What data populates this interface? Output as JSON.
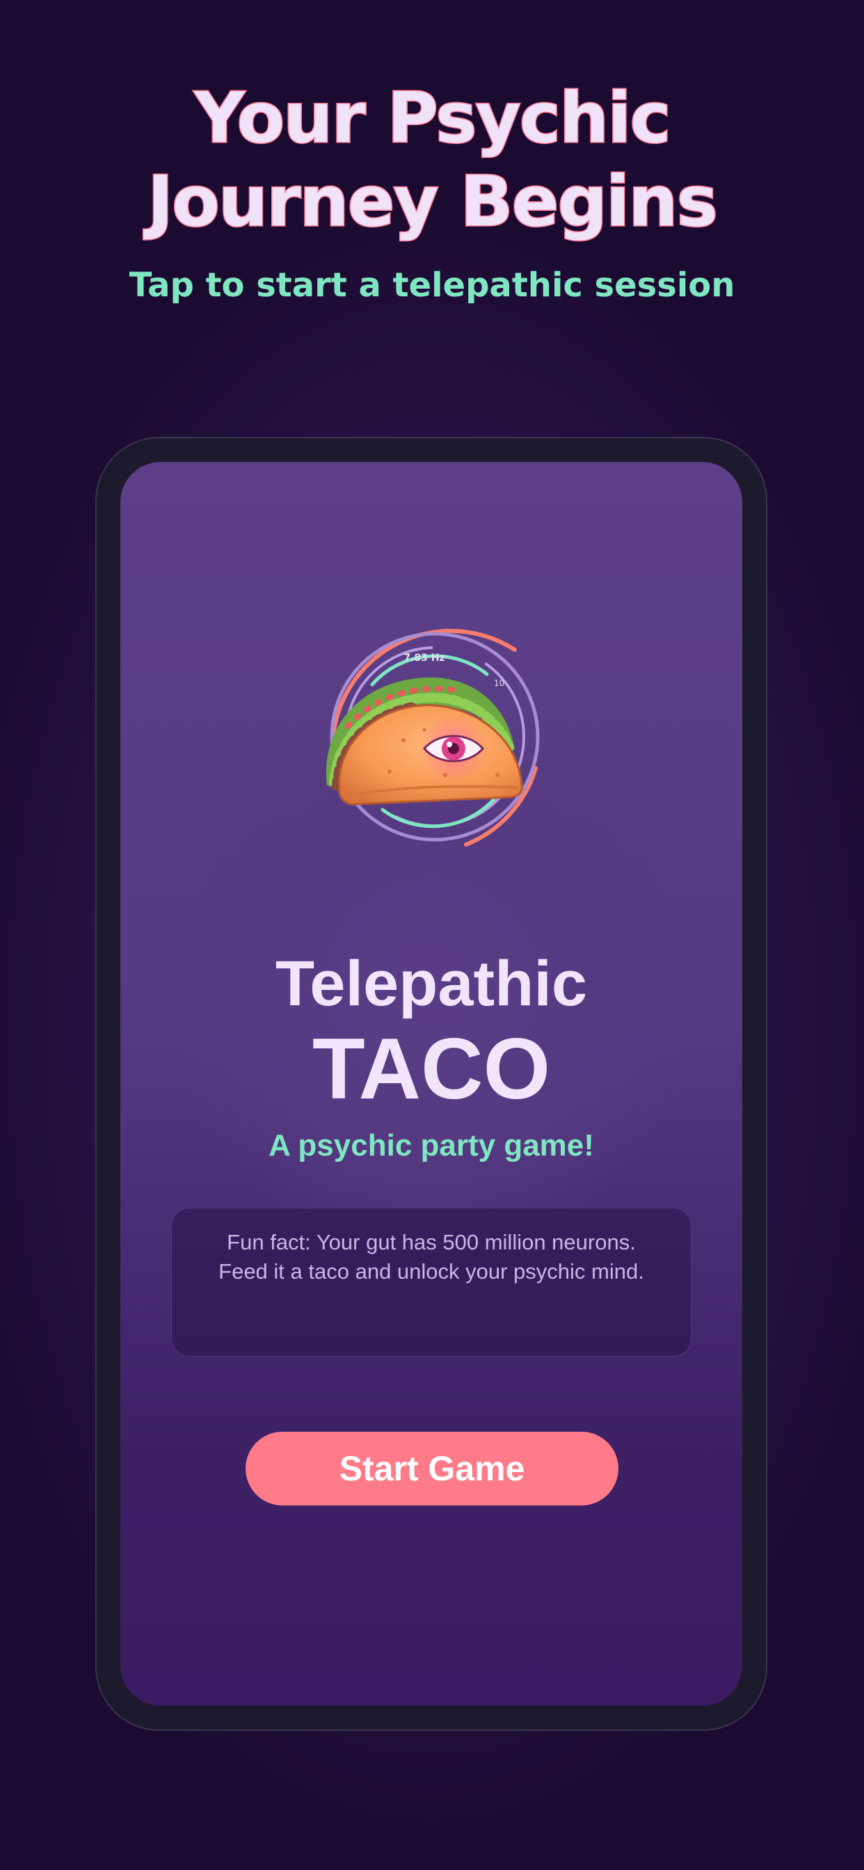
{
  "header": {
    "title_line1": "Your Psychic",
    "title_line2": "Journey Begins",
    "subtitle": "Tap to start a telepathic session"
  },
  "emblem": {
    "icon": "psychic-taco-eye-icon",
    "frequency_label": "7.83 Hz",
    "scale_label": "10"
  },
  "game": {
    "title_line1": "Telepathic",
    "title_line2": "TACO",
    "tagline": "A psychic party game!"
  },
  "fun_fact": {
    "line1": "Fun fact: Your gut has 500 million neurons.",
    "line2": "Feed it a taco and unlock your psychic mind."
  },
  "actions": {
    "start_label": "Start Game"
  },
  "colors": {
    "background": "#1b0b30",
    "title_fill": "#f0e2f8",
    "title_stroke": "#ff7b95",
    "accent_mint": "#7fe6c2",
    "button": "#ff7b8a",
    "phone_frame": "#1c1a2c"
  }
}
